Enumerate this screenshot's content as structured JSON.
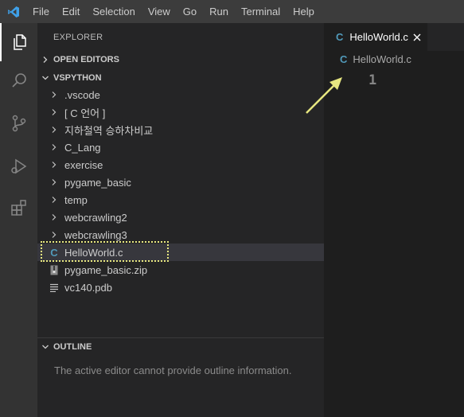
{
  "menu": [
    "File",
    "Edit",
    "Selection",
    "View",
    "Go",
    "Run",
    "Terminal",
    "Help"
  ],
  "activity": {
    "explorer": "files-icon",
    "search": "search-icon",
    "scm": "source-control-icon",
    "debug": "run-debug-icon",
    "extensions": "extensions-icon"
  },
  "sidebar": {
    "title": "EXPLORER",
    "open_editors": "OPEN EDITORS",
    "workspace": "VSPYTHON",
    "folders": [
      ".vscode",
      "[ C 언어 ]",
      "지하철역 승하차비교",
      "C_Lang",
      "exercise",
      "pygame_basic",
      "temp",
      "webcrawling2",
      "webcrawling3"
    ],
    "files": [
      {
        "icon": "C",
        "label": "HelloWorld.c",
        "selected": true
      },
      {
        "icon": "zip",
        "label": "pygame_basic.zip"
      },
      {
        "icon": "lines",
        "label": "vc140.pdb"
      }
    ],
    "outline_header": "OUTLINE",
    "outline_message": "The active editor cannot provide outline information."
  },
  "editor": {
    "tab_icon": "C",
    "tab_label": "HelloWorld.c",
    "breadcrumb_icon": "C",
    "breadcrumb_label": "HelloWorld.c",
    "line_number": "1"
  },
  "colors": {
    "accent_c": "#519aba",
    "highlight": "#e8e880",
    "arrow": "#e6e680"
  }
}
